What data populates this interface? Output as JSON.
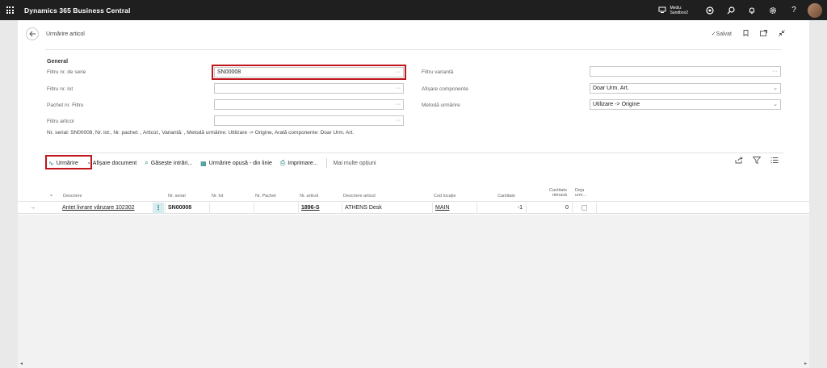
{
  "appbar": {
    "title": "Dynamics 365 Business Central",
    "env_line1": "Mediu:",
    "env_line2": "Sandbox2",
    "icons": [
      "waffle-icon",
      "environment-icon",
      "copilot-icon",
      "search-icon",
      "bell-icon",
      "gear-icon",
      "help-icon"
    ]
  },
  "page": {
    "title": "Urmărire articol",
    "saved_label": "Salvat",
    "general_title": "General",
    "fields": {
      "serial_label": "Filtru nr. de serie",
      "serial_value": "SN00008",
      "lot_label": "Filtru nr. lot",
      "lot_value": "",
      "package_label": "Pachet nr. Filtru",
      "package_value": "",
      "item_label": "Filtru articol",
      "item_value": "",
      "variant_label": "Filtru variantă",
      "variant_value": "",
      "components_label": "Afișare componente",
      "components_value": "Doar Urm. Art.",
      "method_label": "Metodă urmărire",
      "method_value": "Utilizare -> Origine"
    },
    "filter_summary": "Nr. serial: SN00008, Nr. lot:, Nr. pachet: , Articol:, Variantă: , Metodă urmărire: Utilizare -> Origine, Arată componente: Doar Urm. Art."
  },
  "actions": {
    "trace": "Urmărire",
    "show_document": "Afișare document",
    "find_entries": "Găsește intrări...",
    "trace_opposite": "Urmărire opusă - din linie",
    "print": "Imprimare...",
    "more": "Mai multe opțiuni"
  },
  "grid": {
    "columns": [
      "Descriere",
      "Nr. serial",
      "Nr. lot",
      "Nr. Pachet",
      "Nr. articol",
      "Descriere articol",
      "Cod locație",
      "Cantitate",
      "Cantitate rămasă",
      "Deja urm..."
    ],
    "rows": [
      {
        "description": "Antet livrare vânzare 102302",
        "serial": "SN00008",
        "lot": "",
        "package": "",
        "item_no": "1896-S",
        "item_desc": "ATHENS Desk",
        "location": "MAIN",
        "quantity": "-1",
        "remaining": "0"
      }
    ]
  }
}
